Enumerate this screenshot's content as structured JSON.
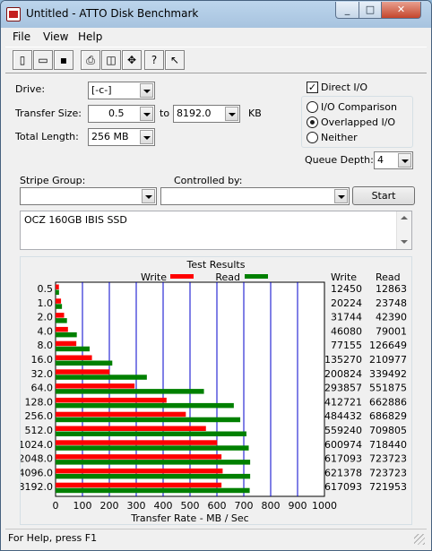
{
  "window": {
    "title": "Untitled - ATTO Disk Benchmark"
  },
  "menu": [
    "File",
    "View",
    "Help"
  ],
  "toolbar": {
    "icons": [
      "new-icon",
      "open-icon",
      "save-icon",
      "print-icon",
      "print-preview-icon",
      "move-icon",
      "help-icon",
      "context-help-icon"
    ]
  },
  "form": {
    "drive_label": "Drive:",
    "drive_value": "[-c-]",
    "transfer_size_label": "Transfer Size:",
    "transfer_from": "0.5",
    "to_label": "to",
    "transfer_to": "8192.0",
    "kb_label": "KB",
    "total_length_label": "Total Length:",
    "total_length_value": "256 MB",
    "direct_io_label": "Direct I/O",
    "direct_io_checked": true,
    "io_mode_options": [
      "I/O Comparison",
      "Overlapped I/O",
      "Neither"
    ],
    "io_mode_selected": "Overlapped I/O",
    "queue_depth_label": "Queue Depth:",
    "queue_depth_value": "4",
    "stripe_group_label": "Stripe Group:",
    "controlled_by_label": "Controlled by:",
    "start_button": "Start",
    "description": "OCZ 160GB IBIS SSD"
  },
  "results": {
    "title": "Test Results",
    "legend_write": "Write",
    "legend_read": "Read",
    "col_write": "Write",
    "col_read": "Read",
    "xlabel": "Transfer Rate - MB / Sec",
    "colors": {
      "write": "#ff0000",
      "read": "#008000",
      "grid": "#0000cc"
    }
  },
  "chart_data": {
    "type": "bar",
    "orientation": "horizontal",
    "title": "Test Results",
    "xlabel": "Transfer Rate - MB / Sec",
    "xlim": [
      0,
      1000
    ],
    "xticks": [
      0,
      100,
      200,
      300,
      400,
      500,
      600,
      700,
      800,
      900,
      1000
    ],
    "categories": [
      "0.5",
      "1.0",
      "2.0",
      "4.0",
      "8.0",
      "16.0",
      "32.0",
      "64.0",
      "128.0",
      "256.0",
      "512.0",
      "1024.0",
      "2048.0",
      "4096.0",
      "8192.0"
    ],
    "series": [
      {
        "name": "Write",
        "values": [
          12450,
          20224,
          31744,
          46080,
          77155,
          135270,
          200824,
          293857,
          412721,
          484432,
          559240,
          600974,
          617093,
          621378,
          617093
        ]
      },
      {
        "name": "Read",
        "values": [
          12863,
          23748,
          42390,
          79001,
          126649,
          210977,
          339492,
          551875,
          662886,
          686829,
          709805,
          718440,
          723723,
          723723,
          721953
        ]
      }
    ]
  },
  "status": {
    "text": "For Help, press F1"
  }
}
